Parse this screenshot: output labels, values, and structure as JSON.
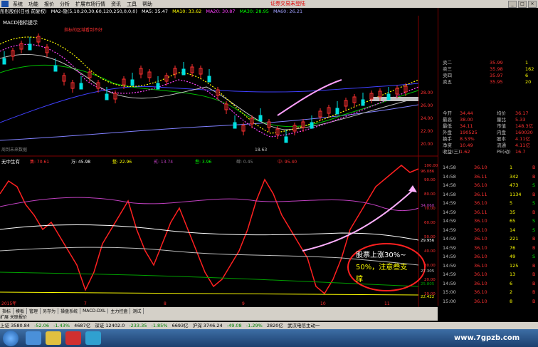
{
  "menubar": {
    "items": [
      "系统",
      "功能",
      "报价",
      "分析",
      "扩展市场行情",
      "资讯",
      "工具",
      "帮助"
    ],
    "brand": "证券交易未登陆"
  },
  "titlebar": {
    "stock": "彤彤股份(日线 前复权)",
    "ma2": "MA2-隐(5,10,20,30,60,120,250,0,0,0)",
    "ma5": "MA5: 35.47",
    "ma10": "MA10: 33.62",
    "ma20": "MA20: 30.87",
    "ma30": "MA30: 28.95",
    "ma60": "MA60: 26.21"
  },
  "chart_upper": {
    "indicator_label": "MACD指标提示",
    "price_low_label": "18.63",
    "no_data_label": "周到未来数据",
    "annotation_text": "指标的区域看到不好"
  },
  "chart_lower": {
    "header": "无中生有",
    "fields": [
      "集: 70.61",
      "万: 45.98",
      "整: 22.96",
      "贰: 13.74",
      "叁: 3.96",
      "肆: 0.45",
      "中: 95.40"
    ],
    "right_values": [
      "96.086",
      "34.060",
      "29.956",
      "27.305",
      "25.805",
      "22.422"
    ],
    "annotation": "股票上涨30%~50%，注意叁支撑"
  },
  "scale_upper": [
    "28.00",
    "26.00",
    "24.00",
    "22.00",
    "20.00"
  ],
  "scale_lower": [
    "100.00",
    "90.00",
    "80.00",
    "70.00",
    "60.00",
    "50.00",
    "40.00",
    "30.00",
    "20.00",
    "10.00"
  ],
  "xaxis": {
    "labels": [
      "2015年",
      "7",
      "8",
      "9",
      "10",
      "11"
    ]
  },
  "quote_panel": {
    "asks": [
      {
        "label": "卖二",
        "price": "35.99",
        "vol": "1"
      },
      {
        "label": "卖三",
        "price": "35.98",
        "vol": "162"
      },
      {
        "label": "卖四",
        "price": "35.97",
        "vol": "6"
      },
      {
        "label": "卖五",
        "price": "35.95",
        "vol": "20"
      }
    ],
    "info": [
      {
        "l1": "今开",
        "v1": "34.44",
        "l2": "均价",
        "v2": "36.17"
      },
      {
        "l1": "最高",
        "v1": "38.00",
        "l2": "量比",
        "v2": "5.33"
      },
      {
        "l1": "最低",
        "v1": "34.11",
        "l2": "市值",
        "v2": "148.3亿"
      },
      {
        "l1": "外盘",
        "v1": "190525",
        "l2": "内盘",
        "v2": "160030"
      },
      {
        "l1": "换手",
        "v1": "8.53%",
        "l2": "股本",
        "v2": "4.11亿"
      },
      {
        "l1": "净资",
        "v1": "10.49",
        "l2": "流通",
        "v2": "4.11亿"
      },
      {
        "l1": "收益(三)",
        "v1": "1.62",
        "l2": "PE(动)",
        "v2": "16.7"
      }
    ],
    "ticks": [
      {
        "t": "14:58",
        "p": "36.10",
        "v": "1",
        "d": "B"
      },
      {
        "t": "14:58",
        "p": "36.11",
        "v": "342",
        "d": "B"
      },
      {
        "t": "14:58",
        "p": "36.10",
        "v": "473",
        "d": "S"
      },
      {
        "t": "14:58",
        "p": "36.11",
        "v": "1134",
        "d": "B"
      },
      {
        "t": "14:59",
        "p": "36.10",
        "v": "5",
        "d": "S"
      },
      {
        "t": "14:59",
        "p": "36.11",
        "v": "35",
        "d": "B"
      },
      {
        "t": "14:59",
        "p": "36.10",
        "v": "65",
        "d": "S"
      },
      {
        "t": "14:59",
        "p": "36.10",
        "v": "14",
        "d": "S"
      },
      {
        "t": "14:59",
        "p": "36.10",
        "v": "221",
        "d": "B"
      },
      {
        "t": "14:59",
        "p": "36.10",
        "v": "76",
        "d": "B"
      },
      {
        "t": "14:59",
        "p": "36.10",
        "v": "49",
        "d": "S"
      },
      {
        "t": "14:59",
        "p": "36.10",
        "v": "125",
        "d": "B"
      },
      {
        "t": "14:59",
        "p": "36.10",
        "v": "13",
        "d": "B"
      },
      {
        "t": "14:59",
        "p": "36.10",
        "v": "6",
        "d": "B"
      },
      {
        "t": "15:00",
        "p": "36.10",
        "v": "2",
        "d": "B"
      },
      {
        "t": "15:00",
        "p": "36.10",
        "v": "8",
        "d": "B"
      }
    ]
  },
  "bottom_tabs": [
    "指标",
    "模板",
    "管理",
    "另存为",
    "操盘系统",
    "MACD-DXL",
    "主力控盘",
    "测试"
  ],
  "bottom_tabs2": [
    "扩展",
    "关联报价"
  ],
  "statusbar": {
    "sh": "上证 3580.84",
    "sh_chg": "-52.06",
    "sh_pct": "-1.43%",
    "sh_amt": "4687亿",
    "sz": "深证 12402.0",
    "sz_chg": "-233.35",
    "sz_pct": "-1.85%",
    "sz_amt": "6693亿",
    "hs": "沪深 3746.24",
    "hs_chg": "-49.08",
    "hs_pct": "-1.29%",
    "hs_amt": "2820亿",
    "ticker": "武汉电信主动一"
  },
  "watermark": "www.7gpzb.com",
  "colors": {
    "up": "#ff3030",
    "down": "#00e0e0",
    "white": "#ffffff",
    "yellow": "#ffff00",
    "magenta": "#c040c0",
    "purple": "#8040ff"
  }
}
